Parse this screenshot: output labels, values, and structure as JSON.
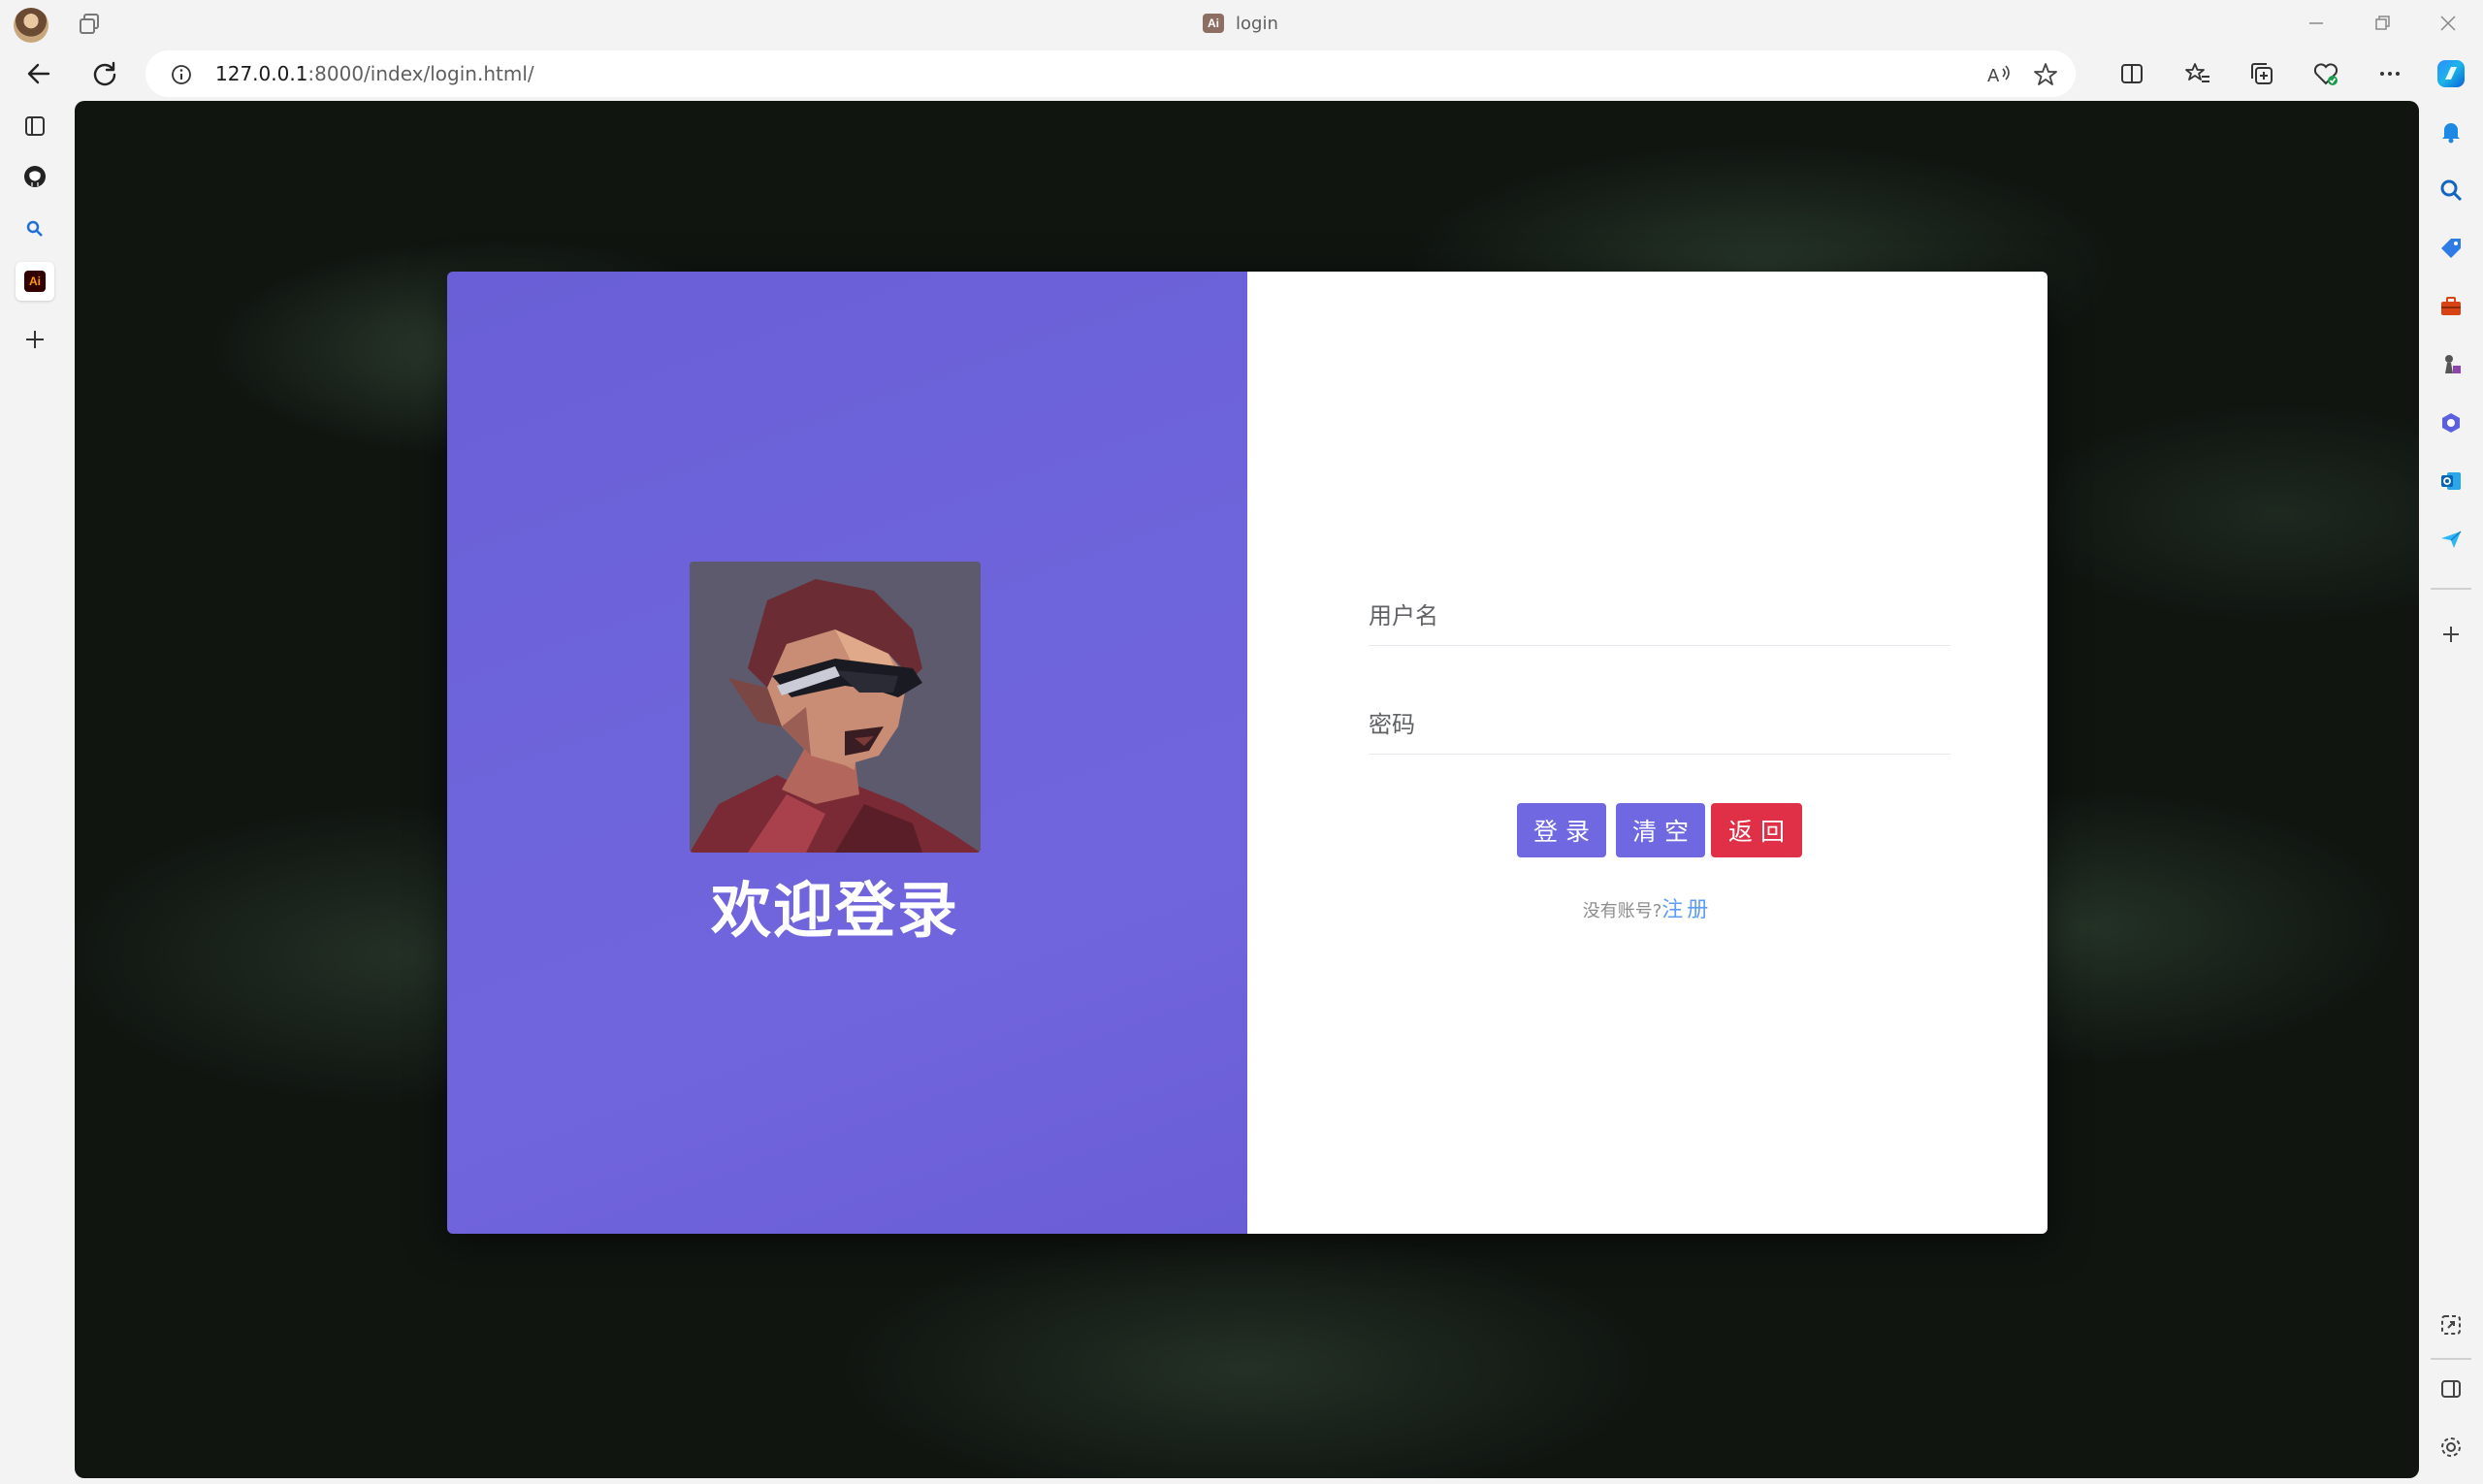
{
  "browser": {
    "tab": {
      "title": "login",
      "favicon_text": "Ai"
    },
    "address_bar": {
      "host": "127.0.0.1",
      "path": ":8000/index/login.html/"
    },
    "left_sidebar": {
      "items": [
        "vertical-tabs-icon",
        "github-icon",
        "search-icon",
        "ai-app-icon",
        "plus-icon"
      ],
      "active_badge": "Ai"
    },
    "right_sidebar": {
      "items": [
        "copilot-icon",
        "bell-icon",
        "search-icon",
        "tag-icon",
        "briefcase-icon",
        "chess-icon",
        "m365-icon",
        "outlook-icon",
        "send-icon",
        "plus-icon",
        "screenshot-icon",
        "sidebar-toggle-icon",
        "settings-icon"
      ]
    },
    "colors": {
      "chrome_bg": "#f3f3f3",
      "accent": "#0f6cbd"
    }
  },
  "page": {
    "welcome_title": "欢迎登录",
    "form": {
      "username_placeholder": "用户名",
      "password_placeholder": "密码",
      "login_button": "登录",
      "clear_button": "清空",
      "back_button": "返回"
    },
    "register": {
      "prompt": "没有账号?",
      "link": "注册"
    },
    "colors": {
      "panel": "#6e64db",
      "primary_button": "#7068e0",
      "danger_button": "#e03048",
      "link": "#5e9cf5"
    }
  }
}
